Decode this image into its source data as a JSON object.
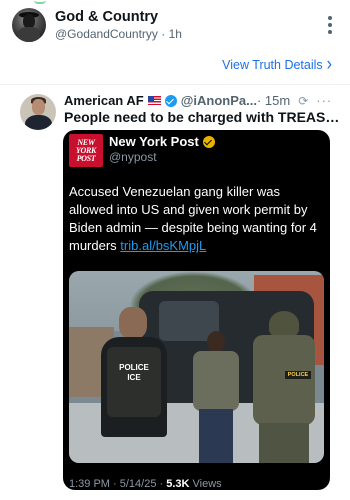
{
  "post": {
    "author_name": "God & Country",
    "author_handle": "@GodandCountryy",
    "separator": "·",
    "age": "1h",
    "view_details_label": "View Truth Details",
    "view_details_chevron": "›"
  },
  "quoted": {
    "author_name": "American AF",
    "flag_icon": "us-flag-icon",
    "verified_icon": "verified-badge-icon",
    "handle": "@iAnonPa...",
    "time": "· 15m",
    "repost_icon": "⟳",
    "more_icon": "···",
    "text": "People need to be charged with TREASON..",
    "embed": {
      "logo_lines": [
        "NEW",
        "YORK",
        "POST"
      ],
      "source_name": "New York Post",
      "source_handle": "@nypost",
      "body": "Accused Venezuelan gang killer was allowed into US and given work permit by Biden admin — despite being wanting for 4 murders ",
      "link": "trib.al/bsKMpjL",
      "photo": {
        "vest_label_line1": "POLICE",
        "vest_label_line2": "ICE",
        "patch_label": "POLICE"
      },
      "footer_prefix": "1:39 PM · 5/14/25 · ",
      "footer_views": "5.3K",
      "footer_suffix": " Views"
    }
  },
  "colors": {
    "link_blue": "#1d70e8",
    "verified_blue": "#1d9bf0",
    "gold_check": "#e8b400",
    "nyp_red": "#c8102e",
    "card_bg": "#000000"
  }
}
